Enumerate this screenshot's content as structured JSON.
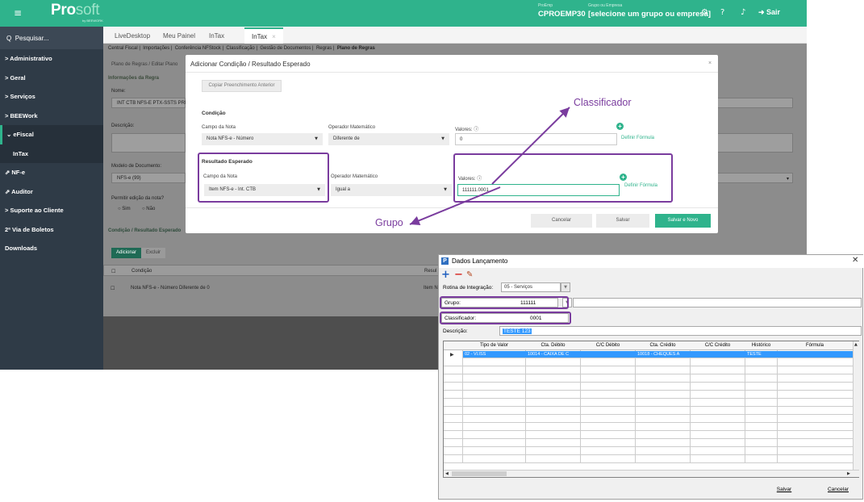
{
  "topbar": {
    "logo_pro": "Pro",
    "logo_soft": "soft",
    "logo_sub": "by BEEWORK",
    "proemp_label": "ProEmp",
    "proemp_value": "CPROEMP30",
    "grupo_label": "Grupo ou Empresa",
    "grupo_value": "[selecione um grupo ou empresa]",
    "sair": "Sair"
  },
  "sidebar": {
    "search": "Pesquisar...",
    "items": [
      "> Administrativo",
      "> Geral",
      "> Serviços",
      "> BEEWork",
      "⌄ eFiscal",
      "InTax",
      "NF-e",
      "Auditor",
      "> Suporte ao Cliente",
      "2ª Via de Boletos",
      "Downloads"
    ]
  },
  "tabs": [
    "LiveDesktop",
    "Meu Painel",
    "InTax",
    "InTax"
  ],
  "background": {
    "subnav": [
      "Central Fiscal",
      "Importações",
      "Conferência NFStock",
      "Classificação",
      "Gestão de Documentos",
      "Regras",
      "Plano de Regras"
    ],
    "breadcrumb": "Plano de Regras / Editar Plano",
    "section_info": "Informações da Regra",
    "nome_label": "Nome:",
    "nome_value": "INT CTB NFS-E PTX-SSTS PRES",
    "descricao_label": "Descrição:",
    "modelo_label": "Modelo de Documento:",
    "modelo_value": "NFS-e (99)",
    "permitir_label": "Permitir edição da nota?",
    "sim": "Sim",
    "nao": "Não",
    "section_condicao": "Condição / Resultado Esperado",
    "btn_adicionar": "Adicionar",
    "btn_excluir": "Excluir",
    "col_condicao": "Condição",
    "col_result": "Resul",
    "row_condicao": "Nota NFS-e - Número Diferente de 0",
    "row_result": "Item N"
  },
  "modal": {
    "title": "Adicionar Condição / Resultado Esperado",
    "close": "×",
    "copiar": "Copiar Preenchimento Anterior",
    "condicao_heading": "Condição",
    "campo_nota_label": "Campo da Nota",
    "operador_label": "Operador Matemático",
    "valores_label": "Valores:",
    "cond_campo": "Nota NFS-e - Número",
    "cond_operador": "Diferente de",
    "cond_valor": "0",
    "definir_formula": "Definir Fórmula",
    "resultado_heading": "Resultado Esperado",
    "res_campo": "Item NFS-e - Int. CTB",
    "res_operador": "Igual a",
    "res_valor": "111111.0001",
    "btn_cancelar": "Cancelar",
    "btn_salvar": "Salvar",
    "btn_salvar_novo": "Salvar e Novo"
  },
  "annotations": {
    "classificador": "Classificador",
    "grupo": "Grupo"
  },
  "dados": {
    "title": "Dados Lançamento",
    "rotina_label": "Rotina de Integração:",
    "rotina_value": "05 - Serviços",
    "grupo_label": "Grupo:",
    "grupo_value": "111111",
    "classificador_label": "Classificador:",
    "classificador_value": "0001",
    "descricao_label": "Descrição:",
    "descricao_value": "TESTE 123",
    "columns": [
      "Tipo de Valor",
      "Cta. Débito",
      "C/C Débito",
      "Cta. Crédito",
      "C/C Crédito",
      "Histórico",
      "Fórmula"
    ],
    "row": [
      "02 - Vl.ISS",
      "10014 - CAIXA DE C",
      "",
      "10018 - CHEQUES A",
      "",
      "TESTE",
      ""
    ],
    "btn_salvar": "Salvar",
    "btn_cancelar": "Cancelar"
  },
  "colors": {
    "accent": "#2fb38c",
    "sidebar": "#2f3b47",
    "highlight": "#7a3c9e",
    "selection": "#3399ff"
  }
}
